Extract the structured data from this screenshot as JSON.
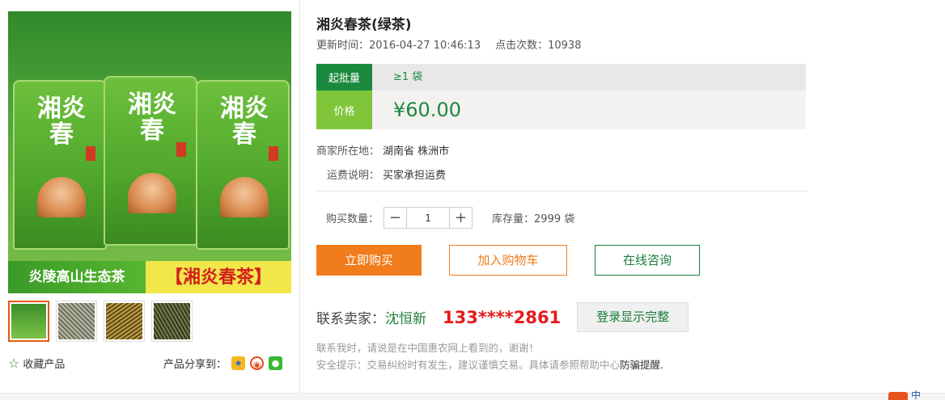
{
  "product": {
    "title": "湘炎春茶(绿茶)",
    "update_label": "更新时间：",
    "update_time": "2016-04-27 10:46:13",
    "clicks_label": "点击次数：",
    "clicks": "10938",
    "image_calligraphy": "湘炎春",
    "banner_left": "炎陵高山生态茶",
    "banner_right": "【湘炎春茶】",
    "thumbnail_count": 4
  },
  "pricing": {
    "moq_label": "起批量",
    "moq_value": "≥1 袋",
    "price_label": "价格",
    "price_value": "¥60.00"
  },
  "details": {
    "location_label": "商家所在地：",
    "location_value": "湖南省 株洲市",
    "shipping_label": "运费说明：",
    "shipping_value": "买家承担运费"
  },
  "purchase": {
    "qty_label": "购买数量：",
    "qty_value": "1",
    "minus": "−",
    "plus": "+",
    "stock_label": "库存量：",
    "stock_value": "2999 袋"
  },
  "actions": {
    "buy": "立即购买",
    "cart": "加入购物车",
    "consult": "在线咨询"
  },
  "seller": {
    "contact_label": "联系卖家：",
    "name": "沈恒新",
    "phone": "133****2861",
    "login_button": "登录显示完整",
    "note": "联系我时，请说是在中国惠农网上看到的，谢谢！",
    "tip_prefix": "安全提示：交易纠纷时有发生，建议谨慎交易。具体请参照帮助中心",
    "tip_link": "防骗提醒",
    "tip_suffix": "."
  },
  "left_footer": {
    "favorite": "收藏产品",
    "share_label": "产品分享到："
  },
  "corner": {
    "text": "中"
  },
  "colors": {
    "green_dark": "#1b8a3e",
    "green_light": "#7fc63b",
    "orange": "#f07c1c",
    "red_phone": "#e51b1b"
  }
}
